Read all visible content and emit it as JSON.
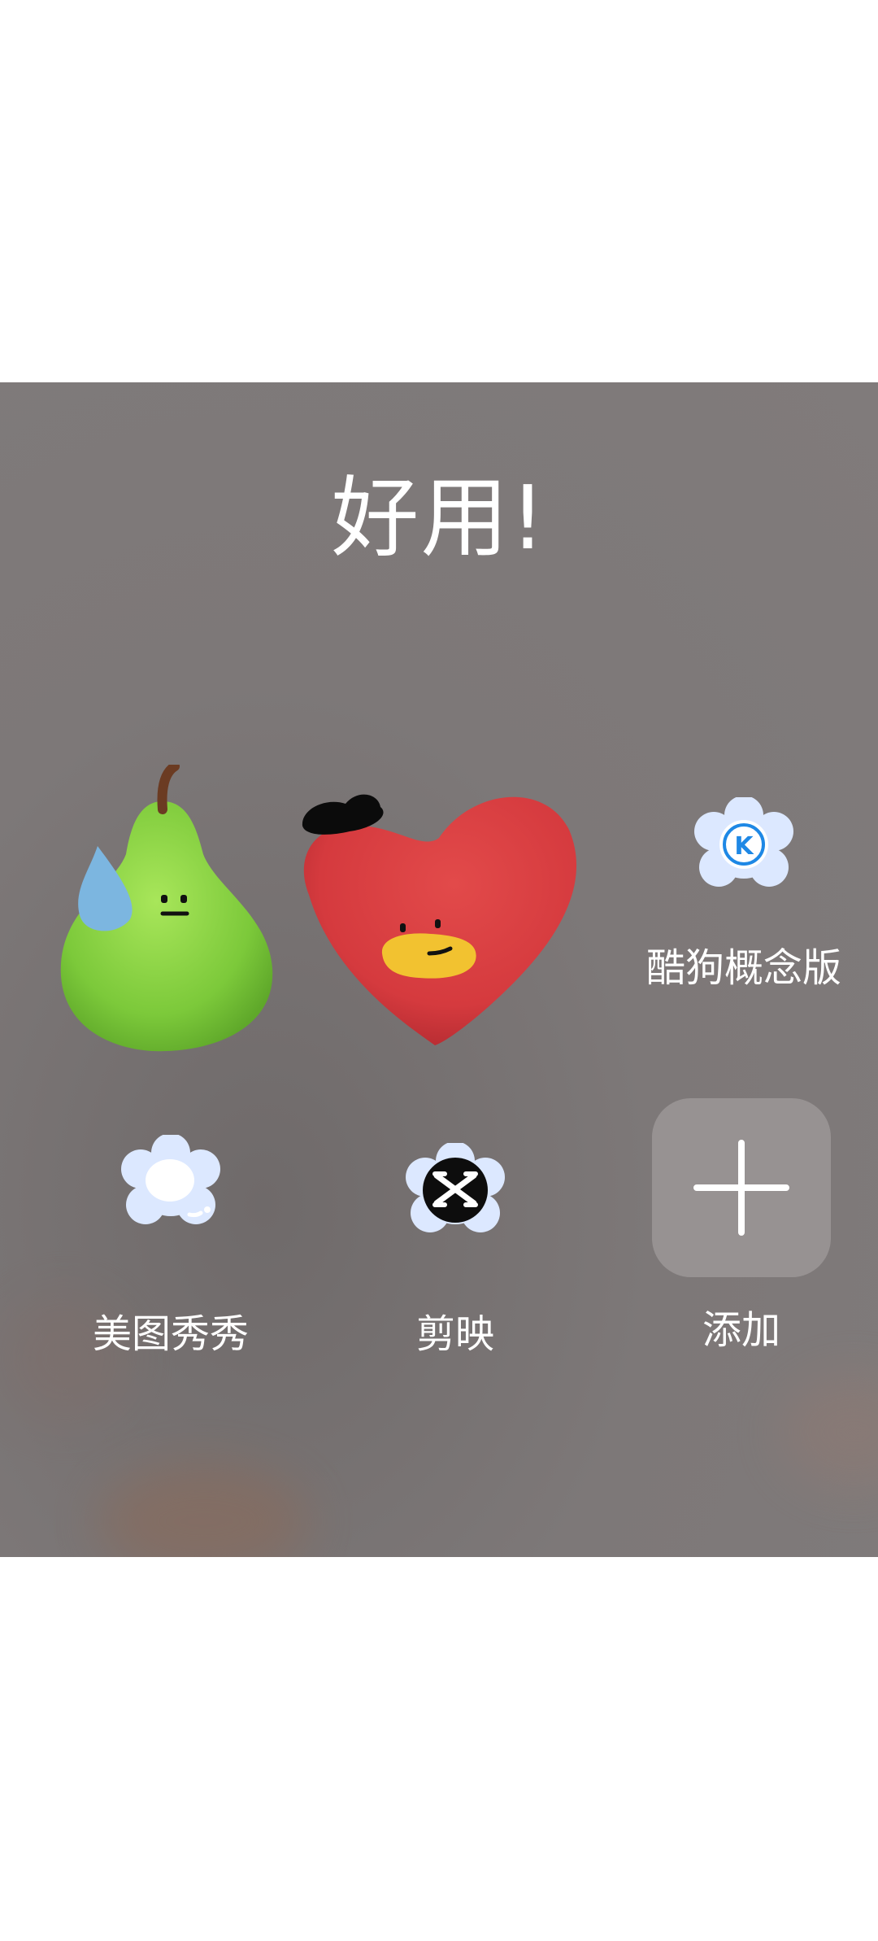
{
  "folder": {
    "title": "好用!"
  },
  "apps": [
    {
      "name": "kugou-concept",
      "label": "酷狗概念版",
      "icon": "kugou-k-icon",
      "icon_letter": "K"
    },
    {
      "name": "meitu",
      "label": "美图秀秀",
      "icon": "meitu-flower-icon"
    },
    {
      "name": "capcut",
      "label": "剪映",
      "icon": "capcut-icon"
    },
    {
      "name": "add",
      "label": "添加",
      "icon": "plus-icon"
    }
  ],
  "stickers": [
    "pear-sticker",
    "heart-sticker"
  ],
  "colors": {
    "panel": "#807b7b",
    "label": "#ffffff",
    "flower": "#dce8ff",
    "kugou_blue": "#1e88e5",
    "heart_red": "#d83a3e",
    "pear_green": "#8fd64a"
  }
}
